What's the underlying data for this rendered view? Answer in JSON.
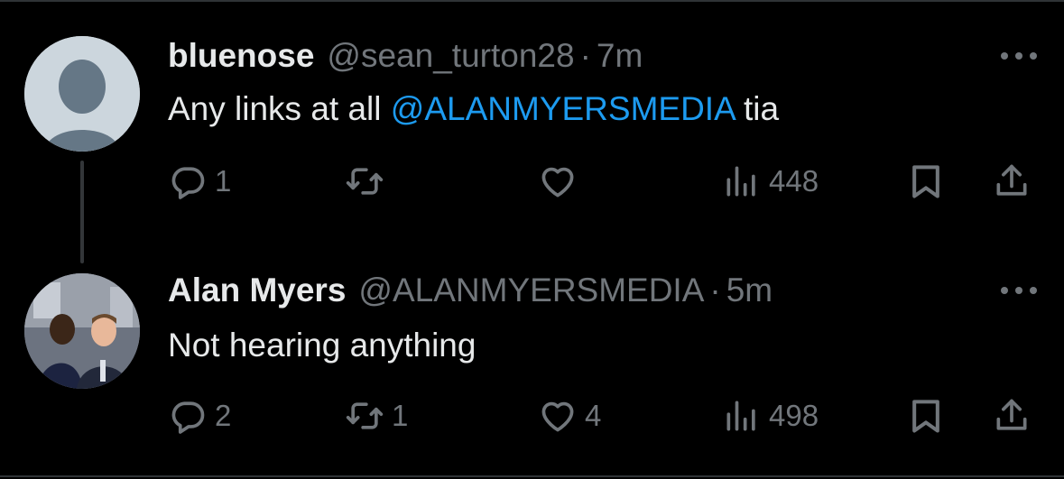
{
  "tweets": [
    {
      "name": "bluenose",
      "handle": "@sean_turton28",
      "separator": "·",
      "time": "7m",
      "text_before": "Any links at all ",
      "mention": "@ALANMYERSMEDIA",
      "text_after": " tia",
      "replies": "1",
      "retweets": "",
      "likes": "",
      "views": "448"
    },
    {
      "name": "Alan Myers",
      "handle": "@ALANMYERSMEDIA",
      "separator": "·",
      "time": "5m",
      "text_before": "Not hearing anything",
      "mention": "",
      "text_after": "",
      "replies": "2",
      "retweets": "1",
      "likes": "4",
      "views": "498"
    }
  ],
  "colors": {
    "background": "#000000",
    "text": "#e7e9ea",
    "muted": "#71767b",
    "accent": "#1d9bf0",
    "thread_line": "#333639"
  },
  "icons": [
    "more-icon",
    "reply-icon",
    "retweet-icon",
    "like-icon",
    "views-icon",
    "bookmark-icon",
    "share-icon"
  ]
}
